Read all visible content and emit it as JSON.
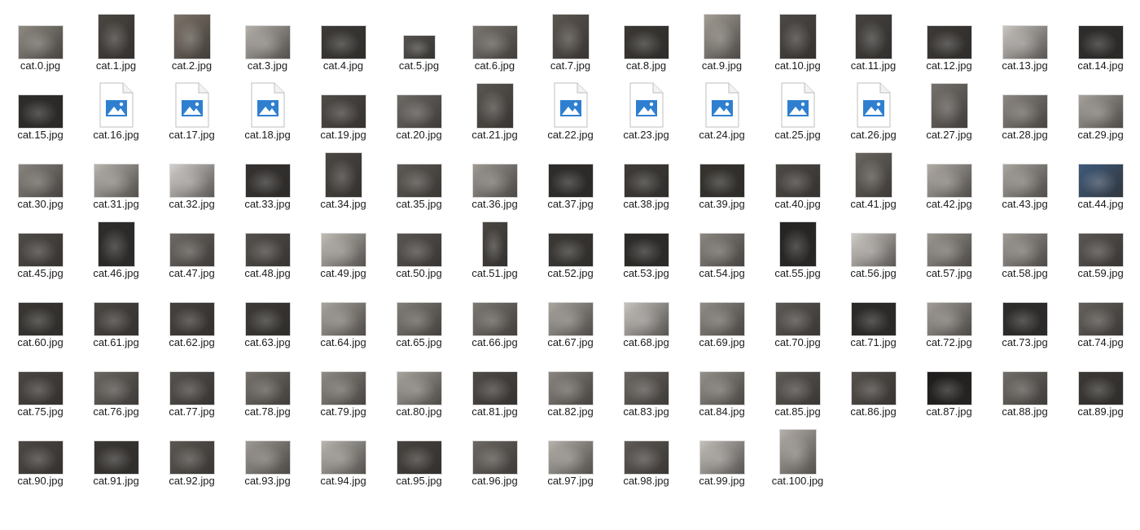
{
  "window": {
    "view": "Large icons",
    "folder_icon_color": "#2f7fd0"
  },
  "files": [
    {
      "name": "cat.0.jpg",
      "kind": "photo",
      "tone": "#8f8a82",
      "shape": "landscape"
    },
    {
      "name": "cat.1.jpg",
      "kind": "photo",
      "tone": "#4a4641",
      "shape": "portrait"
    },
    {
      "name": "cat.2.jpg",
      "kind": "photo",
      "tone": "#7c7268",
      "shape": "portrait"
    },
    {
      "name": "cat.3.jpg",
      "kind": "photo",
      "tone": "#b5b0aa",
      "shape": "landscape"
    },
    {
      "name": "cat.4.jpg",
      "kind": "photo",
      "tone": "#3d3a37",
      "shape": "landscape"
    },
    {
      "name": "cat.5.jpg",
      "kind": "photo",
      "tone": "#55524f",
      "shape": "small"
    },
    {
      "name": "cat.6.jpg",
      "kind": "photo",
      "tone": "#7a756f",
      "shape": "landscape"
    },
    {
      "name": "cat.7.jpg",
      "kind": "photo",
      "tone": "#5c5650",
      "shape": "portrait"
    },
    {
      "name": "cat.8.jpg",
      "kind": "photo",
      "tone": "#3a3734",
      "shape": "landscape"
    },
    {
      "name": "cat.9.jpg",
      "kind": "photo",
      "tone": "#a39d95",
      "shape": "portrait"
    },
    {
      "name": "cat.10.jpg",
      "kind": "photo",
      "tone": "#4d4946",
      "shape": "portrait"
    },
    {
      "name": "cat.11.jpg",
      "kind": "photo",
      "tone": "#45423f",
      "shape": "portrait"
    },
    {
      "name": "cat.12.jpg",
      "kind": "photo",
      "tone": "#3c3936",
      "shape": "landscape"
    },
    {
      "name": "cat.13.jpg",
      "kind": "photo",
      "tone": "#c9c5c0",
      "shape": "landscape"
    },
    {
      "name": "cat.14.jpg",
      "kind": "photo",
      "tone": "#2f2d2b",
      "shape": "landscape"
    },
    {
      "name": "cat.15.jpg",
      "kind": "photo",
      "tone": "#2e2c2a",
      "shape": "landscape"
    },
    {
      "name": "cat.16.jpg",
      "kind": "generic",
      "tone": "#ffffff",
      "shape": "icon"
    },
    {
      "name": "cat.17.jpg",
      "kind": "generic",
      "tone": "#ffffff",
      "shape": "icon"
    },
    {
      "name": "cat.18.jpg",
      "kind": "generic",
      "tone": "#ffffff",
      "shape": "icon"
    },
    {
      "name": "cat.19.jpg",
      "kind": "photo",
      "tone": "#504b47",
      "shape": "landscape"
    },
    {
      "name": "cat.20.jpg",
      "kind": "photo",
      "tone": "#6e6a66",
      "shape": "landscape"
    },
    {
      "name": "cat.21.jpg",
      "kind": "photo",
      "tone": "#5a5550",
      "shape": "portrait"
    },
    {
      "name": "cat.22.jpg",
      "kind": "generic",
      "tone": "#ffffff",
      "shape": "icon"
    },
    {
      "name": "cat.23.jpg",
      "kind": "generic",
      "tone": "#ffffff",
      "shape": "icon"
    },
    {
      "name": "cat.24.jpg",
      "kind": "generic",
      "tone": "#ffffff",
      "shape": "icon"
    },
    {
      "name": "cat.25.jpg",
      "kind": "generic",
      "tone": "#ffffff",
      "shape": "icon"
    },
    {
      "name": "cat.26.jpg",
      "kind": "generic",
      "tone": "#ffffff",
      "shape": "icon"
    },
    {
      "name": "cat.27.jpg",
      "kind": "photo",
      "tone": "#77726d",
      "shape": "portrait"
    },
    {
      "name": "cat.28.jpg",
      "kind": "photo",
      "tone": "#8d8882",
      "shape": "landscape"
    },
    {
      "name": "cat.29.jpg",
      "kind": "photo",
      "tone": "#a7a29c",
      "shape": "landscape"
    },
    {
      "name": "cat.30.jpg",
      "kind": "photo",
      "tone": "#8a857f",
      "shape": "landscape"
    },
    {
      "name": "cat.31.jpg",
      "kind": "photo",
      "tone": "#b8b3ad",
      "shape": "landscape"
    },
    {
      "name": "cat.32.jpg",
      "kind": "photo",
      "tone": "#d4d0cc",
      "shape": "landscape"
    },
    {
      "name": "cat.33.jpg",
      "kind": "photo",
      "tone": "#353230",
      "shape": "landscape"
    },
    {
      "name": "cat.34.jpg",
      "kind": "photo",
      "tone": "#4b4743",
      "shape": "portrait"
    },
    {
      "name": "cat.35.jpg",
      "kind": "photo",
      "tone": "#5f5a55",
      "shape": "landscape"
    },
    {
      "name": "cat.36.jpg",
      "kind": "photo",
      "tone": "#9e9993",
      "shape": "landscape"
    },
    {
      "name": "cat.37.jpg",
      "kind": "photo",
      "tone": "#2f2d2b",
      "shape": "landscape"
    },
    {
      "name": "cat.38.jpg",
      "kind": "photo",
      "tone": "#3f3c39",
      "shape": "landscape"
    },
    {
      "name": "cat.39.jpg",
      "kind": "photo",
      "tone": "#37342f",
      "shape": "landscape"
    },
    {
      "name": "cat.40.jpg",
      "kind": "photo",
      "tone": "#4e4a46",
      "shape": "landscape"
    },
    {
      "name": "cat.41.jpg",
      "kind": "photo",
      "tone": "#6a655f",
      "shape": "portrait"
    },
    {
      "name": "cat.42.jpg",
      "kind": "photo",
      "tone": "#b1aca6",
      "shape": "landscape"
    },
    {
      "name": "cat.43.jpg",
      "kind": "photo",
      "tone": "#aaa59f",
      "shape": "landscape"
    },
    {
      "name": "cat.44.jpg",
      "kind": "photo",
      "tone": "#3f5a7a",
      "shape": "landscape"
    },
    {
      "name": "cat.45.jpg",
      "kind": "photo",
      "tone": "#504c48",
      "shape": "landscape"
    },
    {
      "name": "cat.46.jpg",
      "kind": "photo",
      "tone": "#2e2c2a",
      "shape": "portrait"
    },
    {
      "name": "cat.47.jpg",
      "kind": "photo",
      "tone": "#6f6a65",
      "shape": "landscape"
    },
    {
      "name": "cat.48.jpg",
      "kind": "photo",
      "tone": "#55514d",
      "shape": "landscape"
    },
    {
      "name": "cat.49.jpg",
      "kind": "photo",
      "tone": "#c1bcb6",
      "shape": "landscape"
    },
    {
      "name": "cat.50.jpg",
      "kind": "photo",
      "tone": "#5a5652",
      "shape": "landscape"
    },
    {
      "name": "cat.51.jpg",
      "kind": "photo",
      "tone": "#4a4642",
      "shape": "tall"
    },
    {
      "name": "cat.52.jpg",
      "kind": "photo",
      "tone": "#3c3936",
      "shape": "landscape"
    },
    {
      "name": "cat.53.jpg",
      "kind": "photo",
      "tone": "#2f2d2a",
      "shape": "landscape"
    },
    {
      "name": "cat.54.jpg",
      "kind": "photo",
      "tone": "#8c8781",
      "shape": "landscape"
    },
    {
      "name": "cat.55.jpg",
      "kind": "photo",
      "tone": "#262422",
      "shape": "portrait"
    },
    {
      "name": "cat.56.jpg",
      "kind": "photo",
      "tone": "#d0ccc7",
      "shape": "landscape"
    },
    {
      "name": "cat.57.jpg",
      "kind": "photo",
      "tone": "#9d9892",
      "shape": "landscape"
    },
    {
      "name": "cat.58.jpg",
      "kind": "photo",
      "tone": "#a19c96",
      "shape": "landscape"
    },
    {
      "name": "cat.59.jpg",
      "kind": "photo",
      "tone": "#5b5753",
      "shape": "landscape"
    },
    {
      "name": "cat.60.jpg",
      "kind": "photo",
      "tone": "#3a3734",
      "shape": "landscape"
    },
    {
      "name": "cat.61.jpg",
      "kind": "photo",
      "tone": "#4b4743",
      "shape": "landscape"
    },
    {
      "name": "cat.62.jpg",
      "kind": "photo",
      "tone": "#46423f",
      "shape": "landscape"
    },
    {
      "name": "cat.63.jpg",
      "kind": "photo",
      "tone": "#3d3a37",
      "shape": "landscape"
    },
    {
      "name": "cat.64.jpg",
      "kind": "photo",
      "tone": "#a9a49e",
      "shape": "landscape"
    },
    {
      "name": "cat.65.jpg",
      "kind": "photo",
      "tone": "#837e78",
      "shape": "landscape"
    },
    {
      "name": "cat.66.jpg",
      "kind": "photo",
      "tone": "#7d7872",
      "shape": "landscape"
    },
    {
      "name": "cat.67.jpg",
      "kind": "photo",
      "tone": "#aaa59f",
      "shape": "landscape"
    },
    {
      "name": "cat.68.jpg",
      "kind": "photo",
      "tone": "#c7c3be",
      "shape": "landscape"
    },
    {
      "name": "cat.69.jpg",
      "kind": "photo",
      "tone": "#928d87",
      "shape": "landscape"
    },
    {
      "name": "cat.70.jpg",
      "kind": "photo",
      "tone": "#5d5955",
      "shape": "landscape"
    },
    {
      "name": "cat.71.jpg",
      "kind": "photo",
      "tone": "#2c2a28",
      "shape": "landscape"
    },
    {
      "name": "cat.72.jpg",
      "kind": "photo",
      "tone": "#a29d97",
      "shape": "landscape"
    },
    {
      "name": "cat.73.jpg",
      "kind": "photo",
      "tone": "#2f2d2b",
      "shape": "landscape"
    },
    {
      "name": "cat.74.jpg",
      "kind": "photo",
      "tone": "#65605b",
      "shape": "landscape"
    },
    {
      "name": "cat.75.jpg",
      "kind": "photo",
      "tone": "#4a4643",
      "shape": "landscape"
    },
    {
      "name": "cat.76.jpg",
      "kind": "photo",
      "tone": "#6b6661",
      "shape": "landscape"
    },
    {
      "name": "cat.77.jpg",
      "kind": "photo",
      "tone": "#56524e",
      "shape": "landscape"
    },
    {
      "name": "cat.78.jpg",
      "kind": "photo",
      "tone": "#77726c",
      "shape": "landscape"
    },
    {
      "name": "cat.79.jpg",
      "kind": "photo",
      "tone": "#8f8a84",
      "shape": "landscape"
    },
    {
      "name": "cat.80.jpg",
      "kind": "photo",
      "tone": "#a8a39d",
      "shape": "landscape"
    },
    {
      "name": "cat.81.jpg",
      "kind": "photo",
      "tone": "#4f4b47",
      "shape": "landscape"
    },
    {
      "name": "cat.82.jpg",
      "kind": "photo",
      "tone": "#8a857f",
      "shape": "landscape"
    },
    {
      "name": "cat.83.jpg",
      "kind": "photo",
      "tone": "#6c6762",
      "shape": "landscape"
    },
    {
      "name": "cat.84.jpg",
      "kind": "photo",
      "tone": "#95908a",
      "shape": "landscape"
    },
    {
      "name": "cat.85.jpg",
      "kind": "photo",
      "tone": "#5e5a56",
      "shape": "landscape"
    },
    {
      "name": "cat.86.jpg",
      "kind": "photo",
      "tone": "#55514c",
      "shape": "landscape"
    },
    {
      "name": "cat.87.jpg",
      "kind": "photo",
      "tone": "#1f1d1c",
      "shape": "landscape"
    },
    {
      "name": "cat.88.jpg",
      "kind": "photo",
      "tone": "#726d68",
      "shape": "landscape"
    },
    {
      "name": "cat.89.jpg",
      "kind": "photo",
      "tone": "#3b3835",
      "shape": "landscape"
    },
    {
      "name": "cat.90.jpg",
      "kind": "photo",
      "tone": "#4c4844",
      "shape": "landscape"
    },
    {
      "name": "cat.91.jpg",
      "kind": "photo",
      "tone": "#3a3734",
      "shape": "landscape"
    },
    {
      "name": "cat.92.jpg",
      "kind": "photo",
      "tone": "#5b5752",
      "shape": "landscape"
    },
    {
      "name": "cat.93.jpg",
      "kind": "photo",
      "tone": "#9e9993",
      "shape": "landscape"
    },
    {
      "name": "cat.94.jpg",
      "kind": "photo",
      "tone": "#b9b4ae",
      "shape": "landscape"
    },
    {
      "name": "cat.95.jpg",
      "kind": "photo",
      "tone": "#47433f",
      "shape": "landscape"
    },
    {
      "name": "cat.96.jpg",
      "kind": "photo",
      "tone": "#6d6863",
      "shape": "landscape"
    },
    {
      "name": "cat.97.jpg",
      "kind": "photo",
      "tone": "#b5b0aa",
      "shape": "landscape"
    },
    {
      "name": "cat.98.jpg",
      "kind": "photo",
      "tone": "#5f5a56",
      "shape": "landscape"
    },
    {
      "name": "cat.99.jpg",
      "kind": "photo",
      "tone": "#c3bfba",
      "shape": "landscape"
    },
    {
      "name": "cat.100.jpg",
      "kind": "photo",
      "tone": "#b4afa9",
      "shape": "portrait"
    }
  ]
}
